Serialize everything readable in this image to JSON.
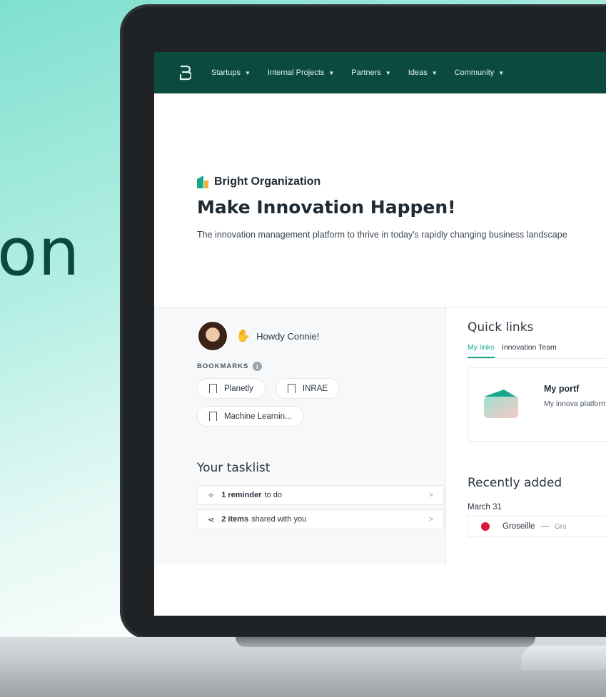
{
  "background": {
    "headline_fragment": "on"
  },
  "nav": {
    "items": [
      {
        "label": "Startups"
      },
      {
        "label": "Internal Projects"
      },
      {
        "label": "Partners"
      },
      {
        "label": "Ideas"
      },
      {
        "label": "Community"
      }
    ],
    "caret": "▼"
  },
  "hero": {
    "org_name": "Bright Organization",
    "title": "Make Innovation Happen!",
    "subtitle": "The innovation management platform to thrive in today's rapidly changing business landscape"
  },
  "greeting": {
    "text": "Howdy Connie!"
  },
  "bookmarks": {
    "title": "BOOKMARKS",
    "info": "i",
    "items": [
      {
        "label": "Planetly"
      },
      {
        "label": "INRAE"
      },
      {
        "label": "Machine Learnin..."
      }
    ]
  },
  "tasklist": {
    "title": "Your tasklist",
    "items": [
      {
        "bold": "1 reminder",
        "text": "to do",
        "chevron": ">"
      },
      {
        "bold": "2 items",
        "text": "shared with you",
        "chevron": ">"
      }
    ]
  },
  "quick_links": {
    "title": "Quick links",
    "tabs": [
      {
        "label": "My links",
        "active": true
      },
      {
        "label": "Innovation Team",
        "active": false
      }
    ],
    "card": {
      "title": "My portf",
      "description": "My innova platform."
    }
  },
  "recently_added": {
    "title": "Recently added",
    "date": "March 31",
    "item": {
      "name": "Groseille",
      "dash": "—",
      "extra": "Gro"
    }
  },
  "colors": {
    "nav_bg": "#0b4a3f",
    "accent": "#1aa88c",
    "item_dot": "#d8173a"
  }
}
